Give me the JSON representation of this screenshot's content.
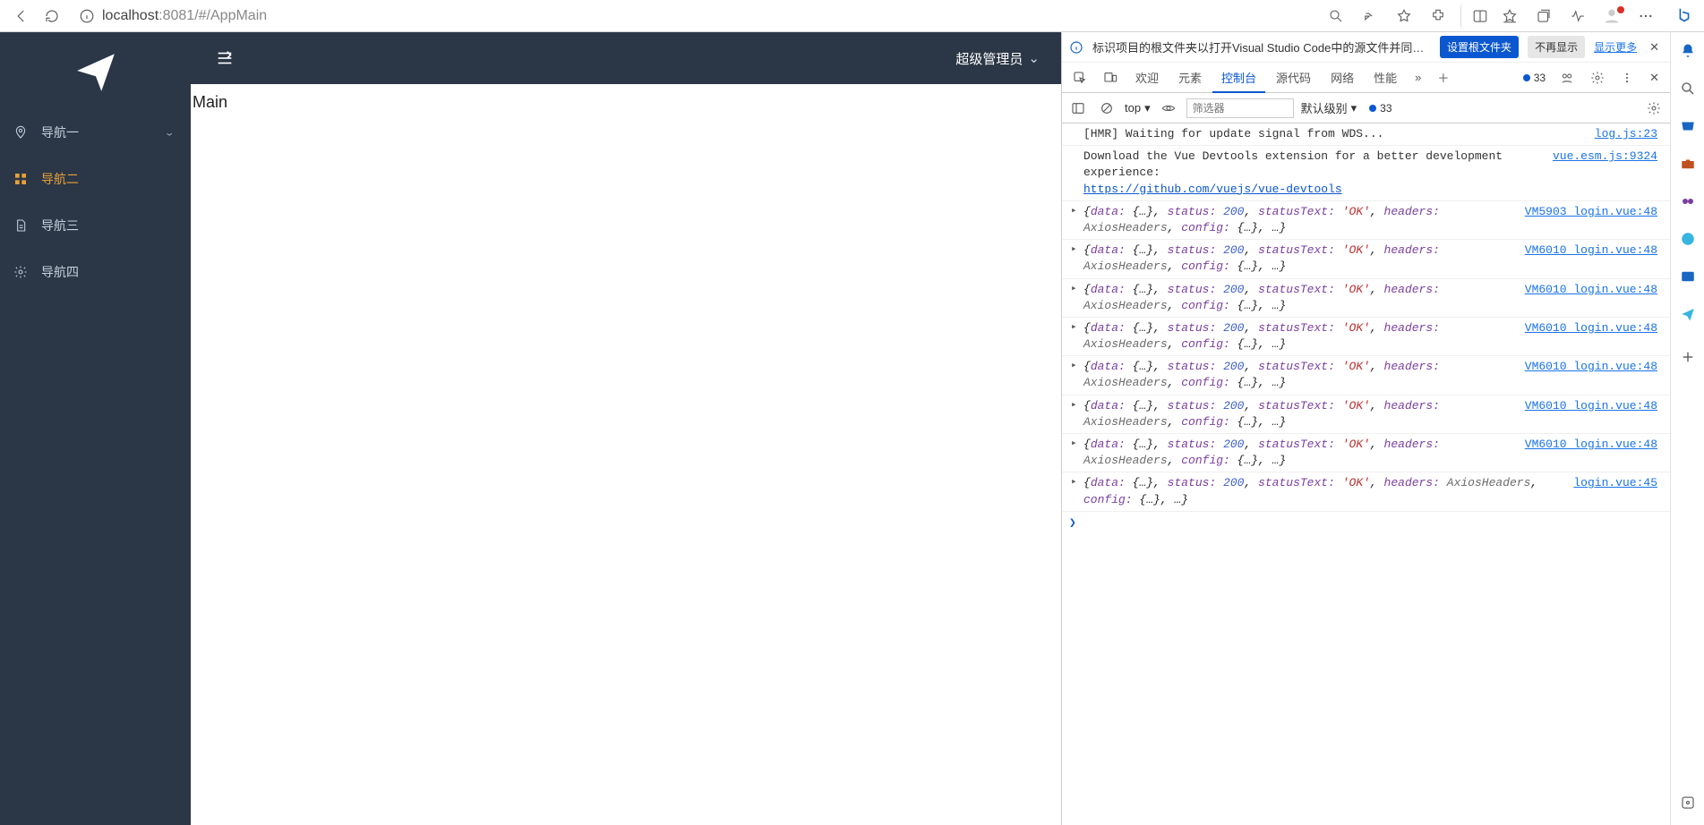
{
  "browser": {
    "url_scheme": "localhost",
    "url_port": ":8081",
    "url_path": "/#/AppMain"
  },
  "edge_sidebar": [],
  "app": {
    "nav": [
      {
        "label": "导航一",
        "expandable": true,
        "active": false
      },
      {
        "label": "导航二",
        "expandable": false,
        "active": true
      },
      {
        "label": "导航三",
        "expandable": false,
        "active": false
      },
      {
        "label": "导航四",
        "expandable": false,
        "active": false
      }
    ],
    "user_label": "超级管理员",
    "body_heading": "Main"
  },
  "devtools": {
    "info_text": "标识项目的根文件夹以打开Visual Studio Code中的源文件并同步更改。",
    "btn_set_root": "设置根文件夹",
    "btn_never": "不再显示",
    "link_more": "显示更多",
    "tabs": [
      "欢迎",
      "元素",
      "控制台",
      "源代码",
      "网络",
      "性能"
    ],
    "active_tab": 2,
    "issue_count_a": "33",
    "issue_count_b": "33",
    "context": "top",
    "filter_placeholder": "筛选器",
    "level_label": "默认级别",
    "log_hmr": "[HMR] Waiting for update signal from WDS...",
    "log_hmr_src": "log.js:23",
    "log_vue_prefix": "Download the Vue Devtools extension for a better development experience: ",
    "log_vue_link": "https://github.com/vuejs/vue-devtools",
    "log_vue_src": "vue.esm.js:9324",
    "obj_line_pre": "{",
    "obj_line": "data: {…}, status: 200, statusText: 'OK', headers: AxiosHeaders, config: {…}, …}",
    "obj_status": "200",
    "obj_status_text": "'OK'",
    "obj_hdr": "AxiosHeaders",
    "sources": [
      "VM5903 login.vue:48",
      "VM6010 login.vue:48",
      "VM6010 login.vue:48",
      "VM6010 login.vue:48",
      "VM6010 login.vue:48",
      "VM6010 login.vue:48",
      "VM6010 login.vue:48",
      "login.vue:45"
    ]
  }
}
